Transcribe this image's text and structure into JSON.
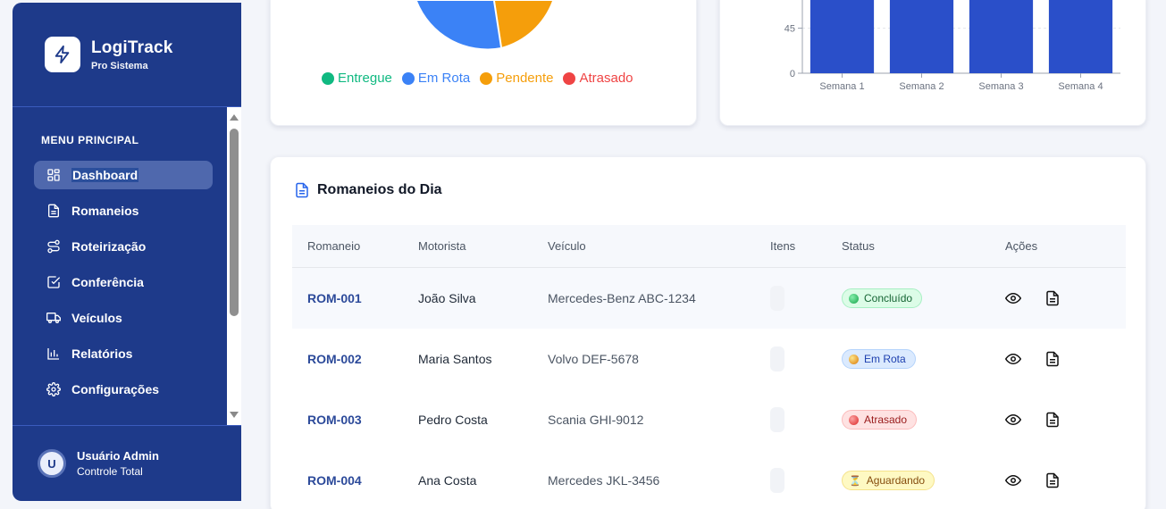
{
  "brand": {
    "name": "LogiTrack",
    "subtitle": "Pro Sistema"
  },
  "menu": {
    "section_title": "MENU PRINCIPAL",
    "items": [
      {
        "label": "Dashboard",
        "icon": "grid-icon",
        "active": true
      },
      {
        "label": "Romaneios",
        "icon": "document-icon"
      },
      {
        "label": "Roteirização",
        "icon": "route-icon"
      },
      {
        "label": "Conferência",
        "icon": "checkbox-icon"
      },
      {
        "label": "Veículos",
        "icon": "truck-icon"
      },
      {
        "label": "Relatórios",
        "icon": "bar-chart-icon"
      },
      {
        "label": "Configurações",
        "icon": "gear-icon"
      }
    ]
  },
  "user": {
    "initial": "U",
    "name": "Usuário Admin",
    "role": "Controle Total"
  },
  "pie_legend": [
    {
      "label": "Entregue",
      "color": "#10b981"
    },
    {
      "label": "Em Rota",
      "color": "#3b82f6"
    },
    {
      "label": "Pendente",
      "color": "#f59e0b"
    },
    {
      "label": "Atrasado",
      "color": "#ef4444"
    }
  ],
  "chart_data": [
    {
      "type": "pie",
      "legend": [
        "Entregue",
        "Em Rota",
        "Pendente",
        "Atrasado"
      ],
      "colors": [
        "#10b981",
        "#3b82f6",
        "#f59e0b",
        "#ef4444"
      ],
      "legend_placement": "bottom"
    },
    {
      "type": "bar",
      "categories": [
        "Semana 1",
        "Semana 2",
        "Semana 3",
        "Semana 4"
      ],
      "values": [
        90,
        90,
        90,
        90
      ],
      "yticks": [
        0,
        45
      ],
      "ylim": [
        0,
        90
      ],
      "color": "#2a4fc9",
      "grid": true
    }
  ],
  "table": {
    "title": "Romaneios do Dia",
    "headers": [
      "Romaneio",
      "Motorista",
      "Veículo",
      "Itens",
      "Status",
      "Ações"
    ],
    "rows": [
      {
        "id": "ROM-001",
        "driver": "João Silva",
        "vehicle": "Mercedes-Benz ABC-1234",
        "status": "Concluído",
        "status_kind": "green"
      },
      {
        "id": "ROM-002",
        "driver": "Maria Santos",
        "vehicle": "Volvo DEF-5678",
        "status": "Em Rota",
        "status_kind": "blue"
      },
      {
        "id": "ROM-003",
        "driver": "Pedro Costa",
        "vehicle": "Scania GHI-9012",
        "status": "Atrasado",
        "status_kind": "red"
      },
      {
        "id": "ROM-004",
        "driver": "Ana Costa",
        "vehicle": "Mercedes JKL-3456",
        "status": "Aguardando",
        "status_kind": "yellow"
      }
    ]
  }
}
